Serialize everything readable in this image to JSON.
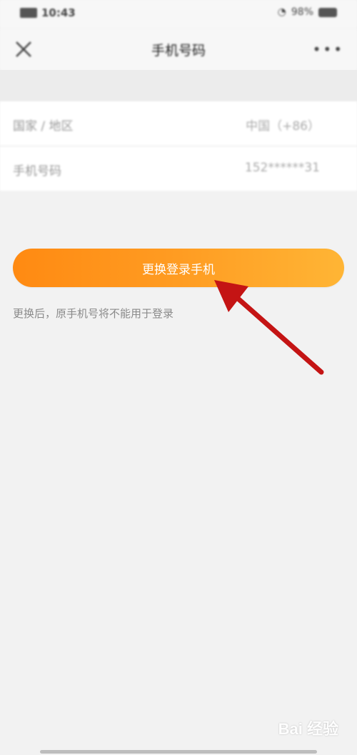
{
  "status_bar": {
    "time": "10:43",
    "battery": "98%"
  },
  "nav": {
    "title": "手机号码",
    "more": "•••"
  },
  "list": {
    "rows": [
      {
        "label": "国家 / 地区",
        "value": "中国（+86）"
      },
      {
        "label": "手机号码",
        "value": "152******31"
      }
    ]
  },
  "main": {
    "button_label": "更换登录手机",
    "hint": "更换后，原手机号将不能用于登录"
  },
  "annotation": {
    "arrow_color": "#c41414"
  },
  "watermark": {
    "text": "Bai 经验"
  },
  "colors": {
    "button_gradient_start": "#ff8a12",
    "button_gradient_end": "#ffb535",
    "background": "#f2f2f2"
  }
}
